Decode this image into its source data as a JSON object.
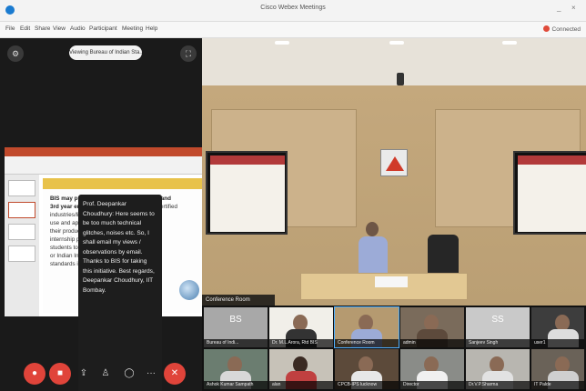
{
  "window": {
    "title": "Cisco Webex Meetings",
    "min": "_",
    "close": "×",
    "app_icon": "webex-logo-icon"
  },
  "menu": [
    "File",
    "Edit",
    "Share",
    "View",
    "Audio",
    "Participant",
    "Meeting",
    "Help"
  ],
  "status": {
    "connected": "Connected",
    "dot_color": "#e04b3a"
  },
  "share": {
    "banner": "Viewing Bureau of Indian Sta..."
  },
  "slide": {
    "text_bold": "BIS may provide",
    "text_bold2": "year and",
    "text_bold3": "3rd year engineeri",
    "lines": [
      "ISS certified",
      "industries/licensees",
      "use and applicat",
      "their production/lab",
      "internship projects",
      "students to analyze",
      "or Indian Industry",
      "standards in India"
    ]
  },
  "chat_tooltip": "Prof. Deepankar Choudhury: Here seems to be too much technical glitches, noises etc. So, I shall email my views / observations by email. Thanks to BIS for taking this initiative. Best regards, Deepankar Choudhury, IIT Bombay.",
  "controls": [
    {
      "name": "mute-button",
      "icon": "microphone-icon",
      "glyph": "🎙",
      "style": "red"
    },
    {
      "name": "stop-video-button",
      "icon": "camera-icon",
      "glyph": "▶",
      "style": "red"
    },
    {
      "name": "share-button",
      "icon": "share-icon",
      "glyph": "⇪",
      "style": "dark"
    },
    {
      "name": "participants-button",
      "icon": "person-icon",
      "glyph": "👤",
      "style": "dark"
    },
    {
      "name": "chat-button",
      "icon": "chat-icon",
      "glyph": "💬",
      "style": "dark"
    },
    {
      "name": "more-button",
      "icon": "more-icon",
      "glyph": "…",
      "style": "dark"
    },
    {
      "name": "leave-button",
      "icon": "close-icon",
      "glyph": "✕",
      "style": "red"
    }
  ],
  "conference_label": "Conference Room",
  "tiles_row1": [
    {
      "name": "Bureau of Indi...",
      "initials": "BS",
      "bg": "#a8a8a8"
    },
    {
      "name": "Dr. M.L.Arora, Rtd BIS",
      "initials": "",
      "bg": "#f1efe9"
    },
    {
      "name": "Conference Room",
      "initials": "",
      "bg": "#b59a70"
    },
    {
      "name": "admin",
      "initials": "",
      "bg": "#7a6b5b"
    },
    {
      "name": "Sanjeev Singh",
      "initials": "SS",
      "bg": "#c9c9c9"
    },
    {
      "name": "user1",
      "initials": "",
      "bg": "#3d3d3d"
    }
  ],
  "tiles_row2": [
    {
      "name": "Ashok Kumar Sampath",
      "initials": "",
      "bg": "#6b7d70"
    },
    {
      "name": "alan",
      "initials": "",
      "bg": "#c7c2b8"
    },
    {
      "name": "CPCB-IPS lucknow",
      "initials": "",
      "bg": "#5c4a3a"
    },
    {
      "name": "Director",
      "initials": "",
      "bg": "#8a8c88"
    },
    {
      "name": "Dr.V.P.Sharma",
      "initials": "",
      "bg": "#b8b6b0"
    },
    {
      "name": "IT Palde",
      "initials": "",
      "bg": "#6a6258"
    }
  ]
}
